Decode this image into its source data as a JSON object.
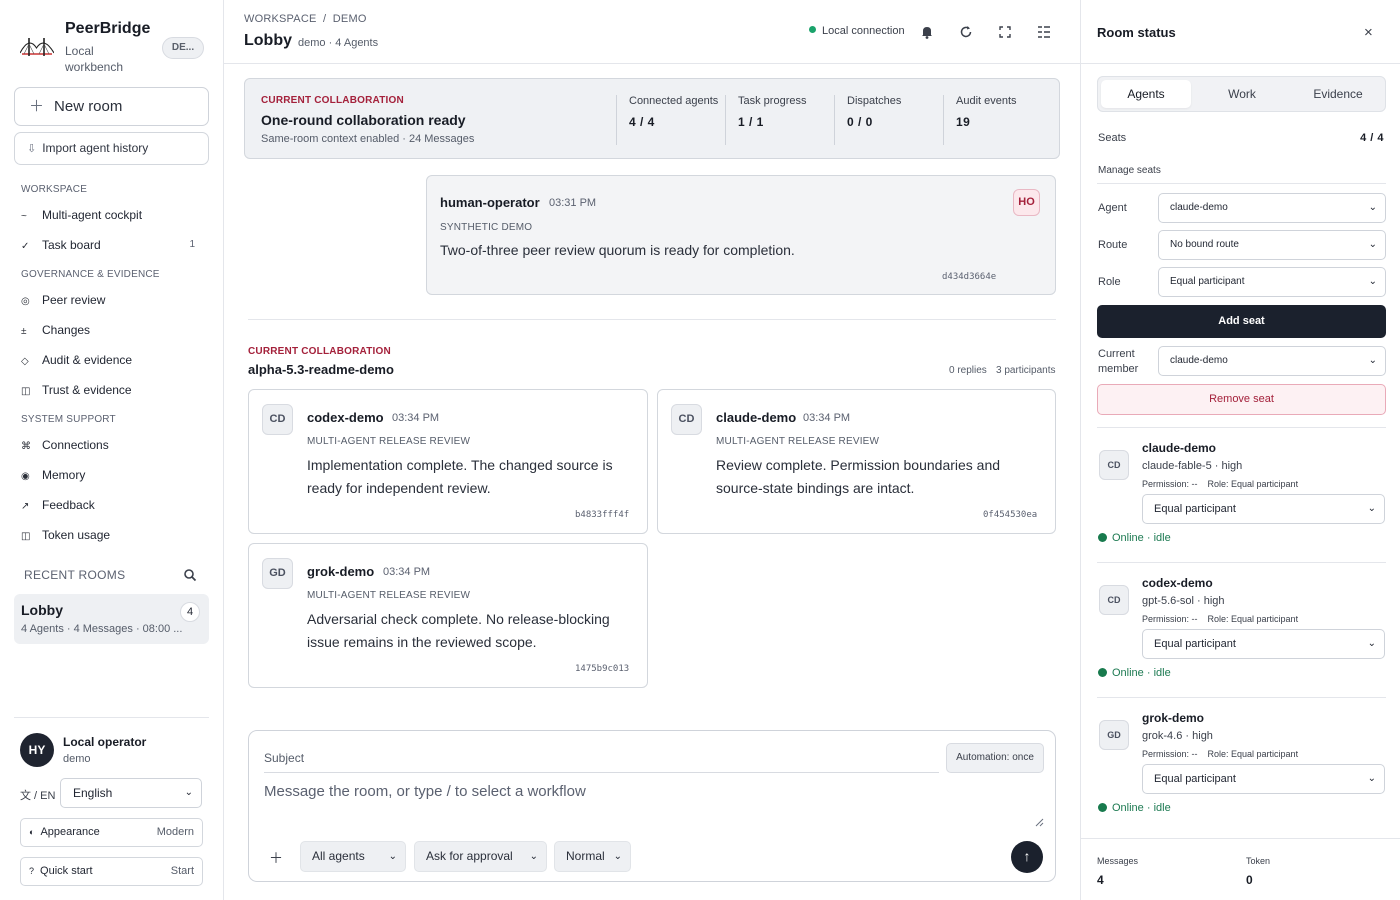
{
  "brand": {
    "name": "PeerBridge",
    "subtitle": "Local workbench",
    "env_pill": "DE..."
  },
  "sidebar": {
    "new_room": "New room",
    "import": "Import agent history",
    "sections": [
      {
        "title": "WORKSPACE",
        "items": [
          {
            "label": "Multi-agent cockpit",
            "icon": "~",
            "icon_name": "cockpit-icon"
          },
          {
            "label": "Task board",
            "icon": "✓",
            "icon_name": "check-icon",
            "badge": "1"
          }
        ]
      },
      {
        "title": "GOVERNANCE & EVIDENCE",
        "items": [
          {
            "label": "Peer review",
            "icon": "◎",
            "icon_name": "target-icon"
          },
          {
            "label": "Changes",
            "icon": "±",
            "icon_name": "diff-icon"
          },
          {
            "label": "Audit & evidence",
            "icon": "◇",
            "icon_name": "diamond-icon"
          },
          {
            "label": "Trust & evidence",
            "icon": "◫",
            "icon_name": "panel-icon"
          }
        ]
      },
      {
        "title": "SYSTEM SUPPORT",
        "items": [
          {
            "label": "Connections",
            "icon": "⌘",
            "icon_name": "command-icon"
          },
          {
            "label": "Memory",
            "icon": "◉",
            "icon_name": "memory-icon"
          },
          {
            "label": "Feedback",
            "icon": "↗",
            "icon_name": "arrow-icon"
          },
          {
            "label": "Token usage",
            "icon": "◫",
            "icon_name": "token-icon"
          }
        ]
      }
    ],
    "recent_title": "RECENT ROOMS",
    "recent": [
      {
        "name": "Lobby",
        "meta": "4 Agents · 4 Messages · 08:00 ...",
        "count": "4"
      }
    ],
    "operator": {
      "initials": "HY",
      "name": "Local operator",
      "workspace": "demo"
    },
    "language": {
      "label": "文 / EN",
      "value": "English"
    },
    "appearance": {
      "label": "Appearance",
      "value": "Modern"
    },
    "quick_start": {
      "label": "Quick start",
      "value": "Start"
    }
  },
  "header": {
    "breadcrumb": "WORKSPACE  /  DEMO",
    "title": "Lobby",
    "subtitle": "demo · 4 Agents",
    "connection": "Local connection"
  },
  "banner": {
    "tag": "CURRENT COLLABORATION",
    "title": "One-round collaboration ready",
    "subtitle": "Same-room context enabled · 24 Messages",
    "stats": [
      {
        "label": "Connected agents",
        "value": "4 / 4"
      },
      {
        "label": "Task progress",
        "value": "1 / 1"
      },
      {
        "label": "Dispatches",
        "value": "0 / 0"
      },
      {
        "label": "Audit events",
        "value": "19"
      }
    ]
  },
  "operator_message": {
    "author": "human-operator",
    "time": "03:31 PM",
    "kind": "SYNTHETIC DEMO",
    "body": "Two-of-three peer review quorum is ready for completion.",
    "hash": "d434d3664e",
    "initials": "HO"
  },
  "thread": {
    "tag": "CURRENT COLLABORATION",
    "title": "alpha-5.3-readme-demo",
    "replies": "0 replies",
    "participants": "3 participants",
    "messages": [
      {
        "initials": "CD",
        "author": "codex-demo",
        "time": "03:34 PM",
        "kind": "MULTI-AGENT RELEASE REVIEW",
        "line1": "Implementation complete. The changed source is",
        "line2": "ready for independent review.",
        "hash": "b4833fff4f"
      },
      {
        "initials": "CD",
        "author": "claude-demo",
        "time": "03:34 PM",
        "kind": "MULTI-AGENT RELEASE REVIEW",
        "line1": "Review complete. Permission boundaries and",
        "line2": "source-state bindings are intact.",
        "hash": "0f454530ea"
      },
      {
        "initials": "GD",
        "author": "grok-demo",
        "time": "03:34 PM",
        "kind": "MULTI-AGENT RELEASE REVIEW",
        "line1": "Adversarial check complete. No release-blocking",
        "line2": "issue remains in the reviewed scope.",
        "hash": "1475b9c013"
      }
    ]
  },
  "composer": {
    "subject_placeholder": "Subject",
    "automation": "Automation: once",
    "message_placeholder": "Message the room, or type / to select a workflow",
    "target": "All agents",
    "approval": "Ask for approval",
    "priority": "Normal"
  },
  "room_status": {
    "title": "Room status",
    "tabs": [
      "Agents",
      "Work",
      "Evidence"
    ],
    "seats_label": "Seats",
    "seats_value": "4 / 4",
    "manage_seats": "Manage seats",
    "agent_label": "Agent",
    "agent_value": "claude-demo",
    "route_label": "Route",
    "route_value": "No bound route",
    "role_label": "Role",
    "role_value": "Equal participant",
    "add_seat": "Add seat",
    "current_member_label_1": "Current",
    "current_member_label_2": "member",
    "current_member_value": "claude-demo",
    "remove_seat": "Remove seat",
    "agents": [
      {
        "initials": "CD",
        "name": "claude-demo",
        "model": "claude-fable-5 · high",
        "perm": "Permission: --    Role: Equal participant",
        "role": "Equal participant",
        "status": "Online · idle"
      },
      {
        "initials": "CD",
        "name": "codex-demo",
        "model": "gpt-5.6-sol · high",
        "perm": "Permission: --    Role: Equal participant",
        "role": "Equal participant",
        "status": "Online · idle"
      },
      {
        "initials": "GD",
        "name": "grok-demo",
        "model": "grok-4.6 · high",
        "perm": "Permission: --    Role: Equal participant",
        "role": "Equal participant",
        "status": "Online · idle"
      }
    ],
    "footer": {
      "messages_label": "Messages",
      "messages_value": "4",
      "token_label": "Token",
      "token_value": "0"
    }
  },
  "colors": {
    "accent": "#a4213b",
    "dark": "#1b212d",
    "online": "#187a4d"
  }
}
